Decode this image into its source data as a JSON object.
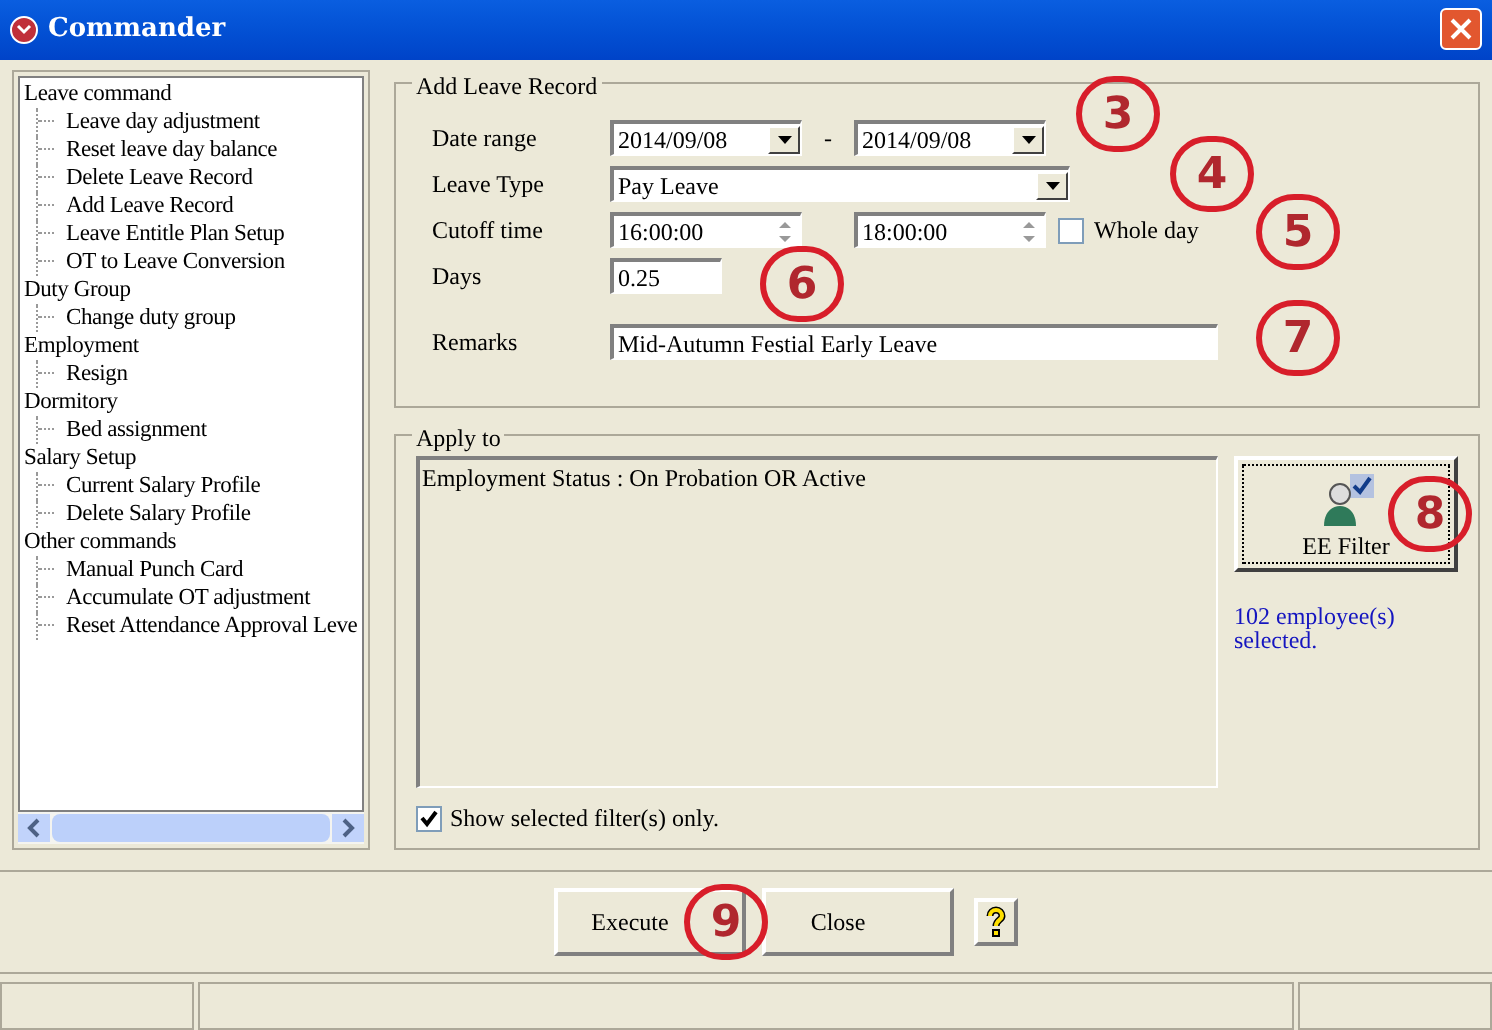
{
  "window": {
    "title": "Commander"
  },
  "tree": [
    {
      "label": "Leave command",
      "children": [
        {
          "label": "Leave day adjustment"
        },
        {
          "label": "Reset leave day balance"
        },
        {
          "label": "Delete Leave Record"
        },
        {
          "label": "Add Leave Record"
        },
        {
          "label": "Leave Entitle Plan Setup"
        },
        {
          "label": "OT to Leave Conversion"
        }
      ]
    },
    {
      "label": "Duty Group",
      "children": [
        {
          "label": "Change duty group"
        }
      ]
    },
    {
      "label": "Employment",
      "children": [
        {
          "label": "Resign"
        }
      ]
    },
    {
      "label": "Dormitory",
      "children": [
        {
          "label": "Bed assignment"
        }
      ]
    },
    {
      "label": "Salary Setup",
      "children": [
        {
          "label": "Current Salary Profile"
        },
        {
          "label": "Delete Salary Profile"
        }
      ]
    },
    {
      "label": "Other commands",
      "children": [
        {
          "label": "Manual Punch Card"
        },
        {
          "label": "Accumulate OT adjustment"
        },
        {
          "label": "Reset Attendance Approval Leve"
        }
      ]
    }
  ],
  "add_leave": {
    "title": "Add Leave Record",
    "date_label": "Date range",
    "date_from": "2014/09/08",
    "date_sep": "-",
    "date_to": "2014/09/08",
    "type_label": "Leave Type",
    "type_value": "Pay Leave",
    "cutoff_label": "Cutoff time",
    "time_from": "16:00:00",
    "time_to": "18:00:00",
    "whole_day": {
      "label": "Whole day",
      "checked": false
    },
    "days_label": "Days",
    "days_value": "0.25",
    "remarks_label": "Remarks",
    "remarks_value": "Mid-Autumn Festial Early Leave"
  },
  "apply_to": {
    "title": "Apply to",
    "filter_text": "Employment Status : On Probation OR Active",
    "filter_button": "EE Filter",
    "count_text": "102 employee(s) selected.",
    "show_selected": {
      "label": "Show selected filter(s) only.",
      "checked": true
    }
  },
  "buttons": [
    "Execute",
    "Close"
  ],
  "annotations": [
    "3",
    "4",
    "5",
    "6",
    "7",
    "8",
    "9"
  ]
}
